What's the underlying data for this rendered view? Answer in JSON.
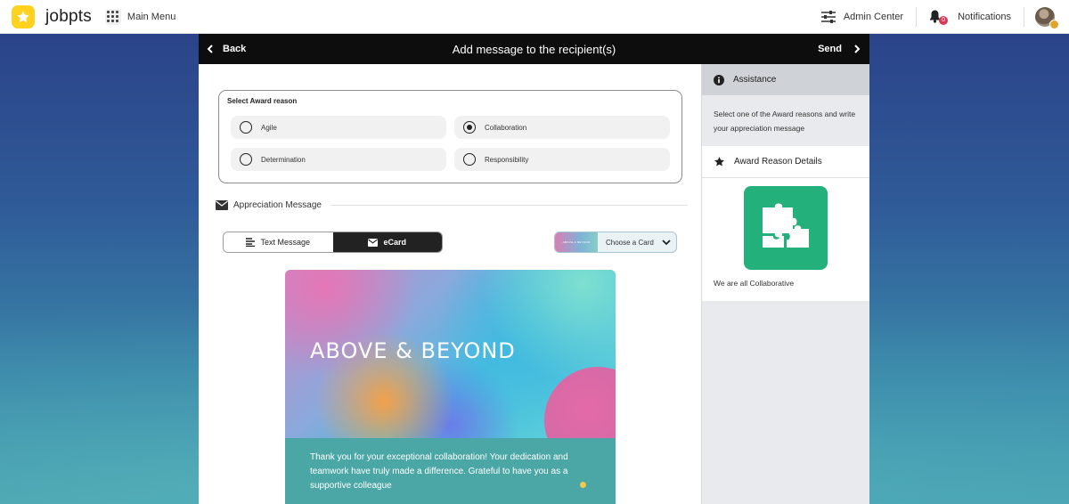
{
  "app": {
    "logo_text": "jobpts",
    "main_menu": "Main Menu"
  },
  "topbar": {
    "admin_center": "Admin Center",
    "notifications": "Notifications",
    "notification_count": "0"
  },
  "header": {
    "back": "Back",
    "title": "Add message to the recipient(s)",
    "send": "Send"
  },
  "award_reason": {
    "title": "Select Award reason",
    "options": [
      {
        "label": "Agile",
        "selected": false
      },
      {
        "label": "Collaboration",
        "selected": true
      },
      {
        "label": "Determination",
        "selected": false
      },
      {
        "label": "Responsibility",
        "selected": false
      }
    ]
  },
  "appreciation": {
    "label": "Appreciation Message",
    "tabs": {
      "text": "Text Message",
      "ecard": "eCard"
    },
    "active_tab": "eCard",
    "card_select_label": "Choose a Card",
    "card_thumb_text": "ABOVE & BEYOND"
  },
  "ecard": {
    "title": "ABOVE & BEYOND",
    "message": "Thank you for your exceptional collaboration! Your dedication and teamwork have truly made a difference. Grateful to have you as a supportive colleague"
  },
  "sidebar": {
    "assistance_title": "Assistance",
    "assistance_text": "Select one of the Award reasons and write your appreciation message",
    "details_title": "Award Reason Details",
    "badge_caption": "We are all Collaborative"
  },
  "colors": {
    "header": "#0d0d0d",
    "logo": "#ffd21f",
    "badge": "#23b07a",
    "ecard_message_bg": "#4aa7a6",
    "notification_badge": "#d83a56"
  }
}
